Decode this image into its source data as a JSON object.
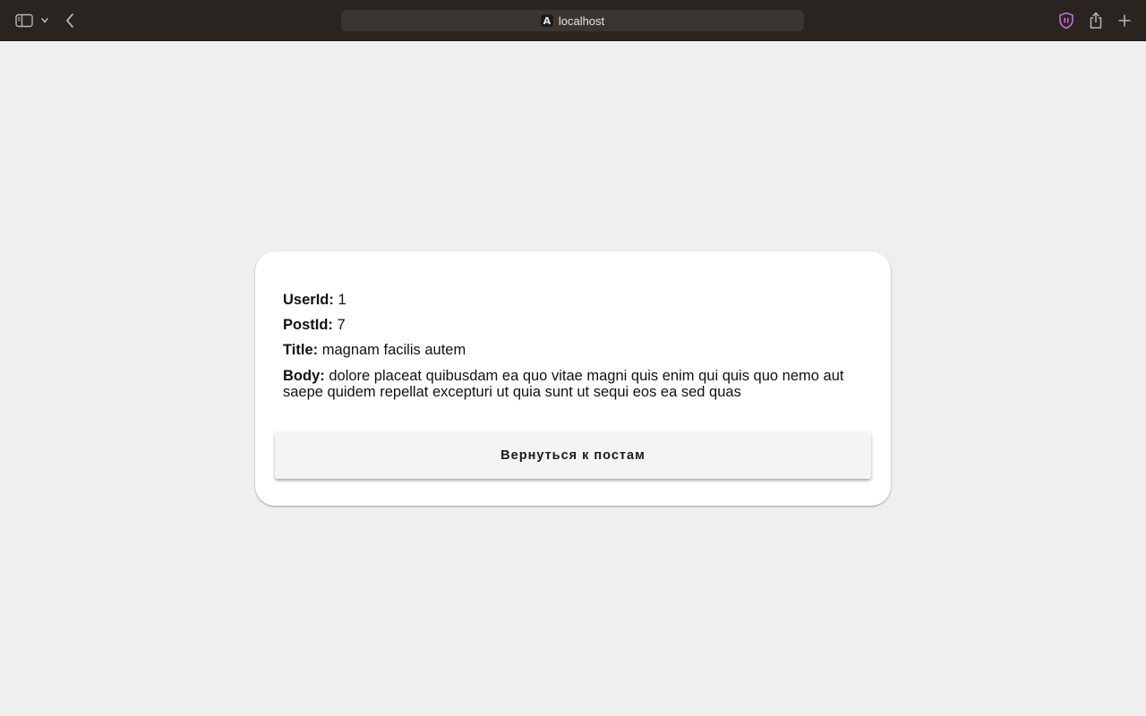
{
  "browser": {
    "url": "localhost",
    "site_icon_letter": "A",
    "icons": [
      "sidebar-icon",
      "chevron-down-icon",
      "back-arrow-icon",
      "shield-icon",
      "share-icon",
      "plus-icon"
    ],
    "colors": {
      "toolbar": "#2a2421",
      "address_bar": "#3b3532",
      "shield_accent": "#c86bd8"
    }
  },
  "post": {
    "user_id_label": "UserId:",
    "user_id": "1",
    "post_id_label": "PostId:",
    "post_id": "7",
    "title_label": "Title:",
    "title": "magnam facilis autem",
    "body_label": "Body:",
    "body": "dolore placeat quibusdam ea quo vitae magni quis enim qui quis quo nemo aut saepe quidem repellat excepturi ut quia sunt ut sequi eos ea sed quas"
  },
  "actions": {
    "back_label": "Вернуться к постам"
  }
}
